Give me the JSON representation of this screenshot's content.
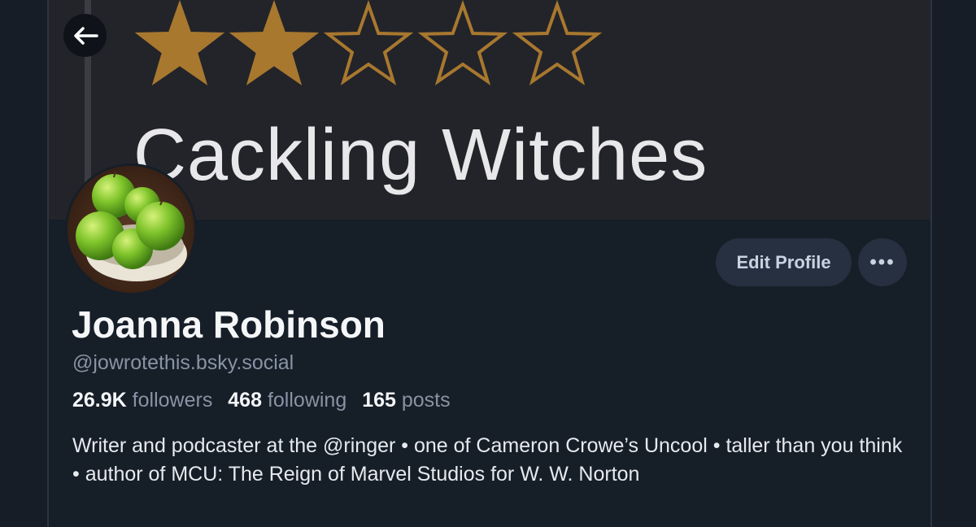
{
  "banner": {
    "rating": 2,
    "max_rating": 5,
    "star_color": "#a8782f",
    "text": "Cackling Witches"
  },
  "profile": {
    "display_name": "Joanna Robinson",
    "handle": "@jowrotethis.bsky.social",
    "followers_count": "26.9K",
    "followers_label": "followers",
    "following_count": "468",
    "following_label": "following",
    "posts_count": "165",
    "posts_label": "posts",
    "bio": "Writer and podcaster at the @ringer • one of Cameron Crowe’s Uncool • taller than you think • author of MCU: The Reign of Marvel Studios for W. W. Norton",
    "avatar": "green-apples-bowl-avatar"
  },
  "actions": {
    "back_icon": "arrow-left-icon",
    "edit_label": "Edit Profile",
    "more_icon": "ellipsis-icon",
    "more_label": "•••"
  }
}
